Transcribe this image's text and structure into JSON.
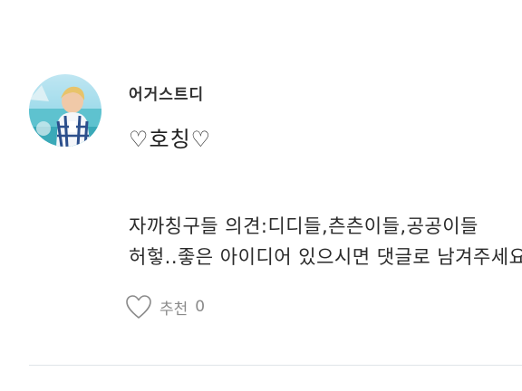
{
  "comment": {
    "author": "어거스트디",
    "title": "♡호칭♡",
    "body_lines": [
      "자까칭구들 의견:디디들,츤츤이들,공공이들",
      "허헣..좋은 아이디어 있으시면 댓글로 남겨주세요!"
    ],
    "like": {
      "icon": "heart-outline-icon",
      "label": "추천",
      "count": "0"
    }
  },
  "colors": {
    "text": "#2b2b2b",
    "muted": "#8a8a8a",
    "divider": "#dfe4e8"
  }
}
